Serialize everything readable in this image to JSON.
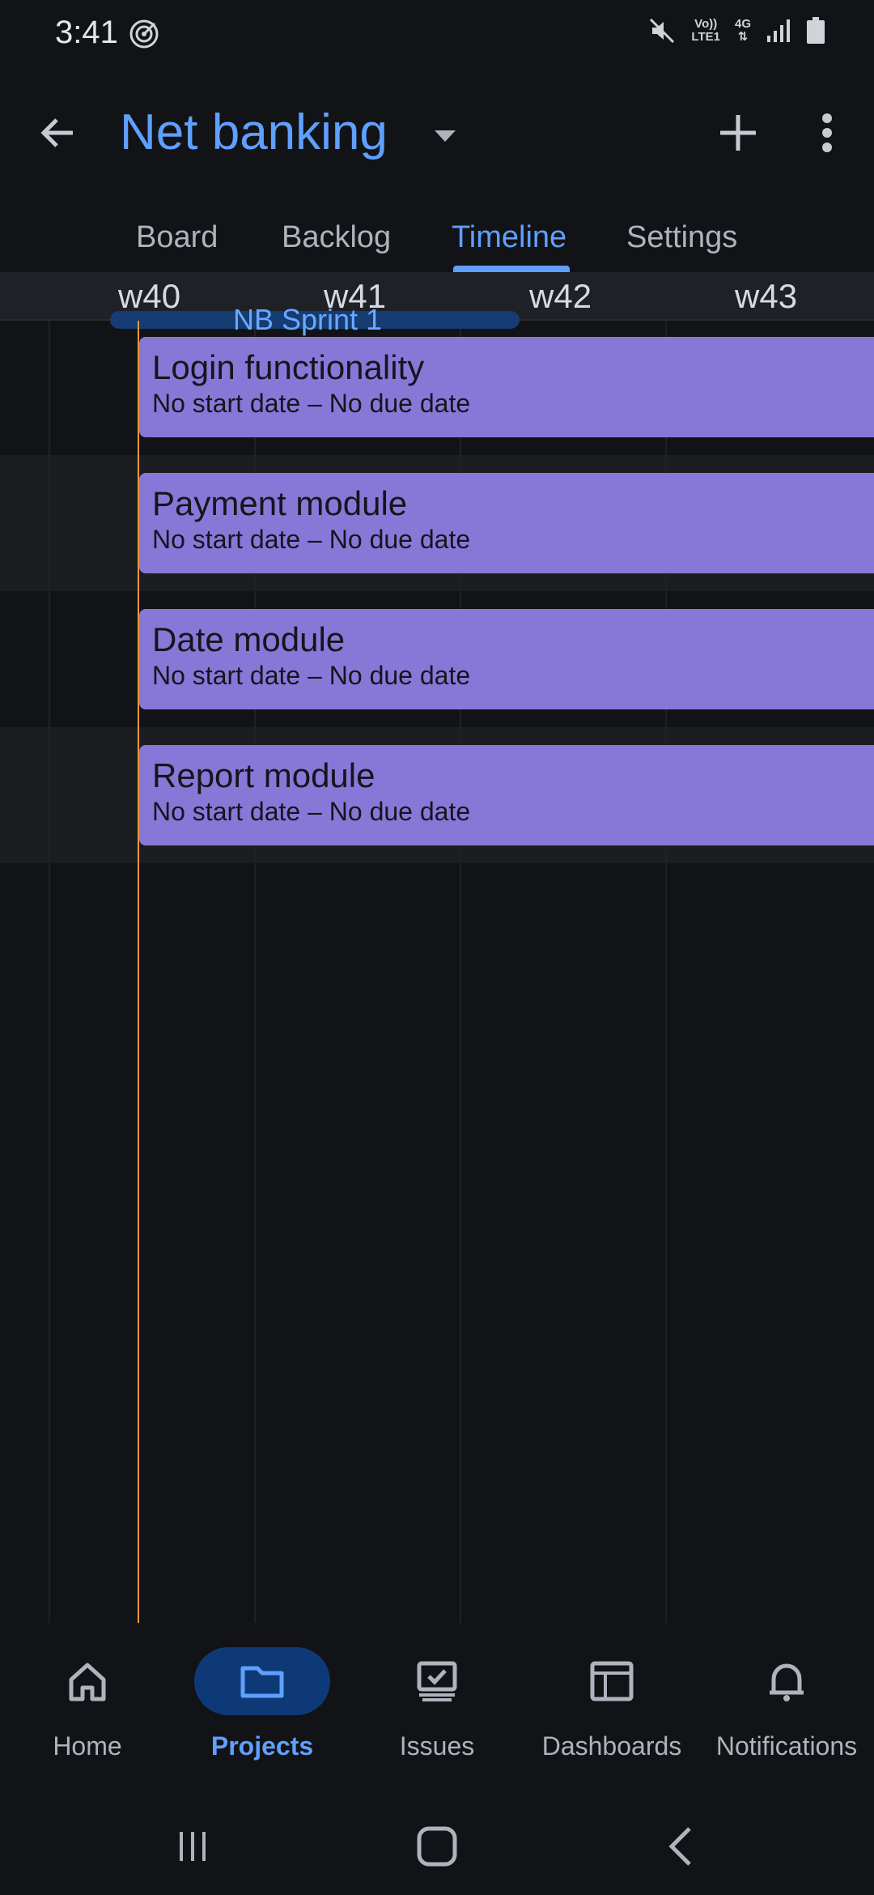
{
  "status_bar": {
    "time": "3:41",
    "network_top": "Vo))",
    "network_bottom": "LTE1",
    "gen": "4G"
  },
  "app_bar": {
    "title": "Net banking",
    "icons": [
      "back-arrow-icon",
      "chevron-down-icon",
      "plus-icon",
      "more-vertical-icon"
    ]
  },
  "tabs": [
    {
      "label": "Board",
      "active": false
    },
    {
      "label": "Backlog",
      "active": false
    },
    {
      "label": "Timeline",
      "active": true
    },
    {
      "label": "Settings",
      "active": false
    }
  ],
  "timeline": {
    "weeks": [
      "w40",
      "w41",
      "w42",
      "w43"
    ],
    "sprint": "NB Sprint 1",
    "issues": [
      {
        "title": "Login functionality",
        "dates": "No start date – No due date"
      },
      {
        "title": "Payment module",
        "dates": "No start date – No due date"
      },
      {
        "title": "Date module",
        "dates": "No start date – No due date"
      },
      {
        "title": "Report module",
        "dates": "No start date – No due date"
      }
    ]
  },
  "bottom_nav": [
    {
      "label": "Home",
      "icon": "home-icon",
      "active": false
    },
    {
      "label": "Projects",
      "icon": "folder-icon",
      "active": true
    },
    {
      "label": "Issues",
      "icon": "issues-icon",
      "active": false
    },
    {
      "label": "Dashboards",
      "icon": "dashboard-icon",
      "active": false
    },
    {
      "label": "Notifications",
      "icon": "bell-icon",
      "active": false
    }
  ],
  "colors": {
    "accent": "#5fa0ff",
    "issue_bar": "#8778d8",
    "today_line": "#e39a3a",
    "sprint_bar": "#153c73",
    "background": "#121316"
  }
}
